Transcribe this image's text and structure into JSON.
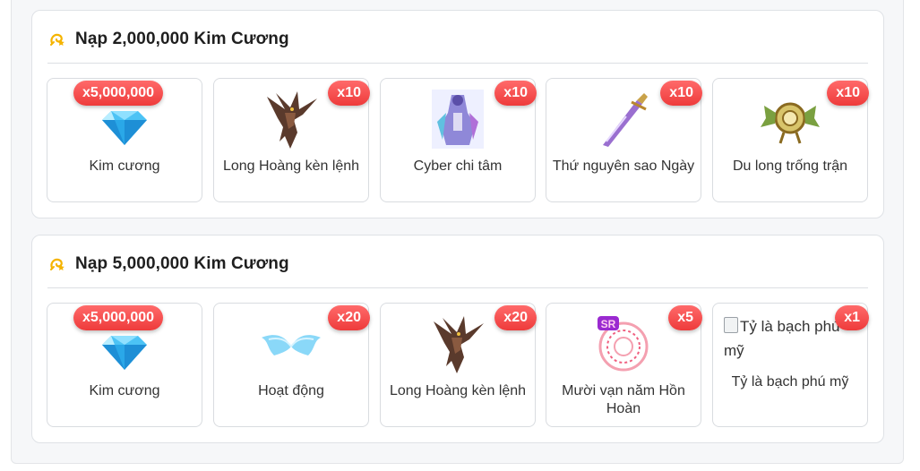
{
  "sections": [
    {
      "title": "Nạp 2,000,000 Kim Cương",
      "items": [
        {
          "badge": "x5,000,000",
          "name": "Kim cương",
          "icon": "diamond-icon"
        },
        {
          "badge": "x10",
          "name": "Long Hoàng kèn lệnh",
          "icon": "dragon-icon"
        },
        {
          "badge": "x10",
          "name": "Cyber chi tâm",
          "icon": "cyber-figure-icon"
        },
        {
          "badge": "x10",
          "name": "Thứ nguyên sao Ngày",
          "icon": "sword-icon"
        },
        {
          "badge": "x10",
          "name": "Du long trống trận",
          "icon": "war-drum-icon"
        }
      ]
    },
    {
      "title": "Nạp 5,000,000 Kim Cương",
      "items": [
        {
          "badge": "x5,000,000",
          "name": "Kim cương",
          "icon": "diamond-icon"
        },
        {
          "badge": "x20",
          "name": "Hoạt động",
          "icon": "ice-wings-icon"
        },
        {
          "badge": "x20",
          "name": "Long Hoàng kèn lệnh",
          "icon": "dragon-icon"
        },
        {
          "badge": "x5",
          "name": "Mười vạn năm Hồn Hoàn",
          "icon": "soul-ring-icon",
          "tag": "SR"
        },
        {
          "badge": "x1",
          "name": "Tỷ là bạch phú mỹ",
          "icon": "broken-image-icon",
          "alt": "Tỷ là bạch phú mỹ"
        }
      ]
    }
  ],
  "colors": {
    "badge": "#ee3b3b",
    "title": "#1f1f1f",
    "diamond": "#3fb6f0"
  }
}
